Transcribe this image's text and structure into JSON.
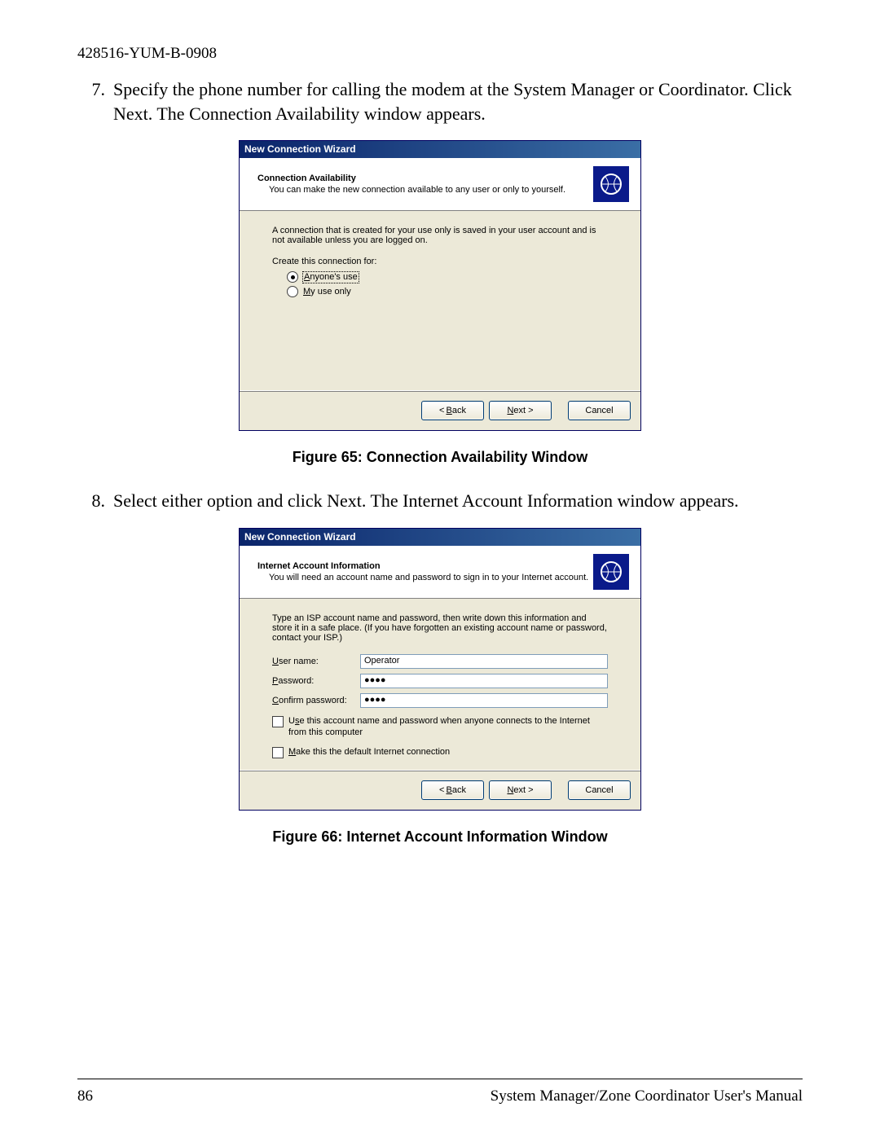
{
  "doc_id": "428516-YUM-B-0908",
  "steps": {
    "s7": {
      "num": "7.",
      "text": "Specify the phone number for calling the modem at the System Manager or Coordinator. Click Next. The Connection Availability window appears."
    },
    "s8": {
      "num": "8.",
      "text": "Select either option and click Next. The Internet Account Information window appears."
    }
  },
  "figures": {
    "f65": "Figure 65: Connection Availability Window",
    "f66": "Figure 66: Internet Account Information Window"
  },
  "dlg1": {
    "title": "New Connection Wizard",
    "header_title": "Connection Availability",
    "header_sub": "You can make the new connection available to any user or only to yourself.",
    "info": "A connection that is created for your use only is saved in your user account and is not available unless you are logged on.",
    "create_label": "Create this connection for:",
    "opt_anyone_pre": "A",
    "opt_anyone_rest": "nyone's use",
    "opt_my_pre": "M",
    "opt_my_rest": "y use only",
    "back": "< Back",
    "next": "Next >",
    "cancel": "Cancel"
  },
  "dlg2": {
    "title": "New Connection Wizard",
    "header_title": "Internet Account Information",
    "header_sub": "You will need an account name and password to sign in to your Internet account.",
    "info": "Type an ISP account name and password, then write down this information and store it in a safe place. (If you have forgotten an existing account name or password, contact your ISP.)",
    "user_pre": "U",
    "user_rest": "ser name:",
    "user_value": "Operator",
    "pass_pre": "P",
    "pass_rest": "assword:",
    "pass_value": "●●●●",
    "conf_pre": "C",
    "conf_rest": "onfirm password:",
    "conf_value": "●●●●",
    "chk_use_pre": "U",
    "chk_use_mid": "s",
    "chk_use_rest": "e this account  name and password when anyone connects to the Internet from this computer",
    "chk_def_pre": "M",
    "chk_def_rest": "ake this the default Internet connection",
    "back": "< Back",
    "next": "Next >",
    "cancel": "Cancel"
  },
  "footer": {
    "page": "86",
    "manual": "System Manager/Zone Coordinator User's Manual"
  }
}
